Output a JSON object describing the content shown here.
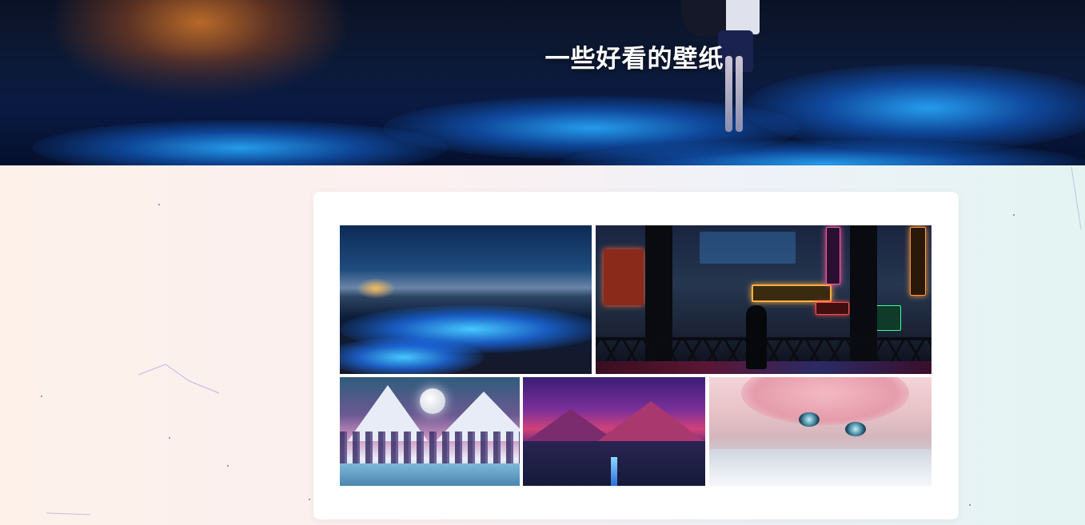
{
  "banner": {
    "title": "一些好看的壁纸"
  },
  "gallery": {
    "images": [
      {
        "name": "night-beach-wallpaper",
        "alt": ""
      },
      {
        "name": "neon-city-wallpaper",
        "alt": ""
      },
      {
        "name": "moon-mountains-wallpaper",
        "alt": ""
      },
      {
        "name": "purple-mountains-wallpaper",
        "alt": ""
      },
      {
        "name": "anime-girl-water-wallpaper",
        "alt": ""
      }
    ]
  },
  "colors": {
    "page_bg_left": "#fdf1ea",
    "page_bg_right": "#e3f4f2",
    "card_bg": "#ffffff",
    "title_color": "#ffffff"
  }
}
